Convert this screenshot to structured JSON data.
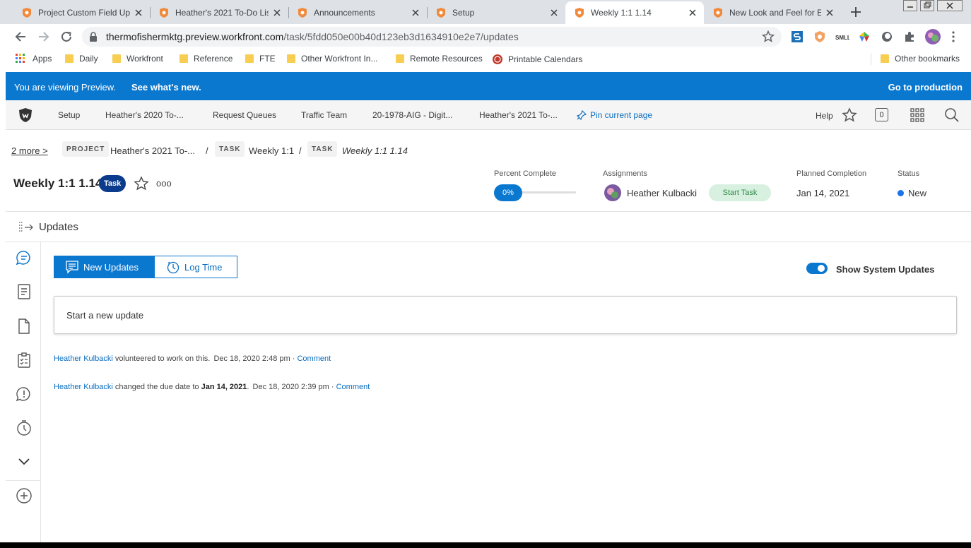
{
  "browser": {
    "tabs": [
      {
        "title": "Project Custom Field Up",
        "active": false
      },
      {
        "title": "Heather's 2021 To-Do Lis",
        "active": false
      },
      {
        "title": "Announcements",
        "active": false
      },
      {
        "title": "Setup",
        "active": false
      },
      {
        "title": "Weekly 1:1 1.14",
        "active": true
      },
      {
        "title": "New Look and Feel for E",
        "active": false
      }
    ],
    "url_host": "thermofishermktg.preview.workfront.com",
    "url_path": "/task/5fdd050e00b40d123eb3d1634910e2e7/updates",
    "bookmarks": [
      "Apps",
      "Daily",
      "Workfront",
      "Reference",
      "FTE",
      "Other Workfront In...",
      "Remote Resources",
      "Printable Calendars"
    ],
    "other_bookmarks": "Other bookmarks"
  },
  "preview_banner": {
    "text": "You are viewing Preview.",
    "link": "See what's new.",
    "right_link": "Go to production"
  },
  "topnav": {
    "items": [
      "Setup",
      "Heather's 2020 To-...",
      "Request Queues",
      "Traffic Team",
      "20-1978-AIG - Digit...",
      "Heather's 2021 To-..."
    ],
    "pin": "Pin current page",
    "help": "Help",
    "notifications_count": "0"
  },
  "breadcrumb": {
    "more": "2 more",
    "project_tag": "PROJECT",
    "project_name": "Heather's 2021 To-...",
    "sep": "/",
    "task_tag": "TASK",
    "task_parent": "Weekly 1:1",
    "task_tag2": "TASK",
    "task_current": "Weekly 1:1 1.14"
  },
  "task": {
    "title": "Weekly 1:1 1.14",
    "badge": "Task",
    "more": "ooo",
    "percent_label": "Percent Complete",
    "percent_value": "0%",
    "percent_fraction": 0,
    "assignments_label": "Assignments",
    "assignee": "Heather Kulbacki",
    "start_button": "Start Task",
    "planned_label": "Planned Completion",
    "planned_value": "Jan 14, 2021",
    "status_label": "Status",
    "status_value": "New",
    "status_color": "#1a73e8"
  },
  "updates": {
    "heading": "Updates",
    "new_updates": "New Updates",
    "log_time": "Log Time",
    "show_system": "Show System Updates",
    "show_system_on": true,
    "placeholder": "Start a new update",
    "feed": [
      {
        "user": "Heather Kulbacki",
        "text": "volunteered to work on this.",
        "bold": "",
        "text_after": "",
        "time": "Dec 18, 2020 2:48 pm",
        "dot": "·",
        "comment": "Comment"
      },
      {
        "user": "Heather Kulbacki",
        "text": "changed the due date to",
        "bold": "Jan 14, 2021",
        "text_after": ".",
        "time": "Dec 18, 2020 2:39 pm",
        "dot": "·",
        "comment": "Comment"
      }
    ]
  },
  "colors": {
    "accent": "#0b78d0",
    "start_task_bg": "#d8f0df",
    "start_task_text": "#2e8b4a"
  }
}
